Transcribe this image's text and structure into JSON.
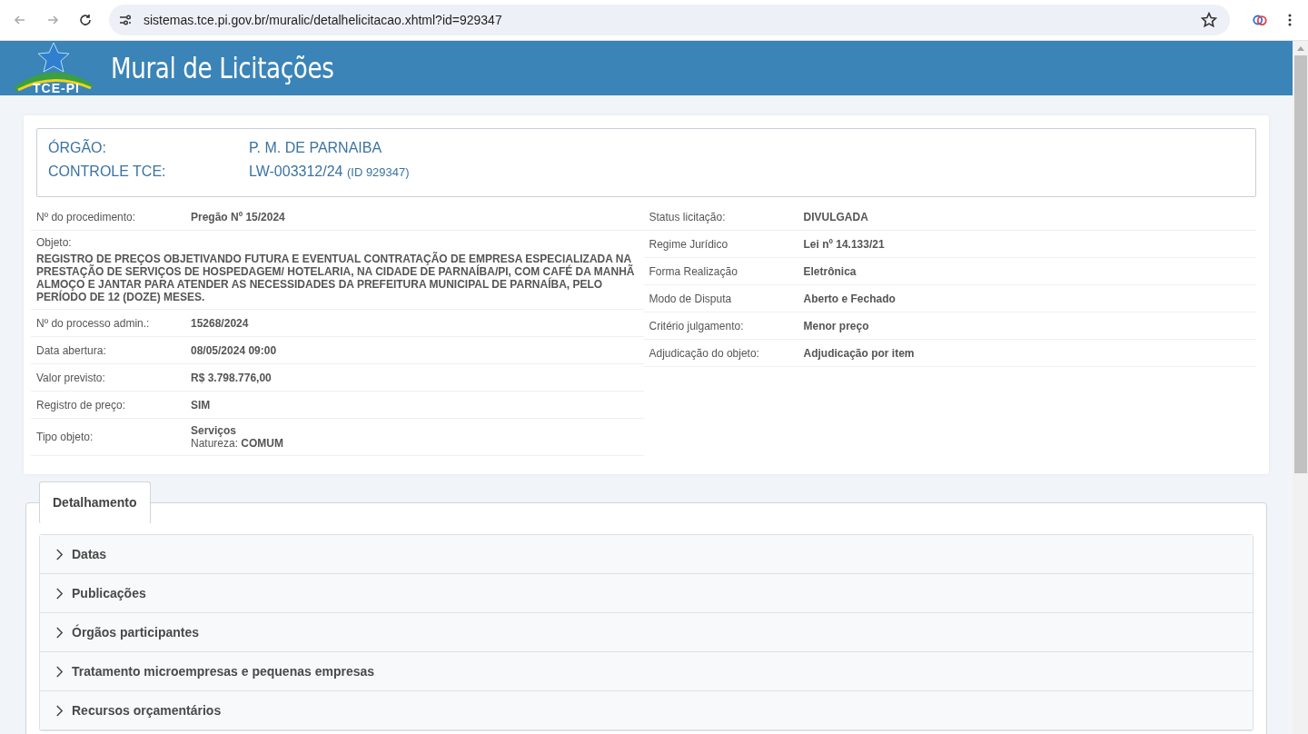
{
  "browser": {
    "url": "sistemas.tce.pi.gov.br/muralic/detalhelicitacao.xhtml?id=929347"
  },
  "header": {
    "logo_text": "TCE-PI",
    "title": "Mural de Licitações"
  },
  "summary": [
    {
      "label": "ÓRGÃO:",
      "value": "P. M. DE PARNAIBA"
    },
    {
      "label": "CONTROLE TCE:",
      "value": "LW-003312/24",
      "note": "(ID 929347)"
    }
  ],
  "details_left": [
    {
      "label": "Nº do procedimento:",
      "value": "Pregão Nº 15/2024"
    },
    {
      "kind": "block",
      "label": "Objeto:",
      "value": "REGISTRO DE PREÇOS OBJETIVANDO FUTURA E EVENTUAL CONTRATAÇÃO DE EMPRESA ESPECIALIZADA NA PRESTAÇÃO DE SERVIÇOS DE HOSPEDAGEM/ HOTELARIA, NA CIDADE DE PARNAÍBA/PI, COM CAFÉ DA MANHÃ ALMOÇO E JANTAR PARA ATENDER AS NECESSIDADES DA PREFEITURA MUNICIPAL DE PARNAÍBA, PELO PERÍODO DE 12 (DOZE) MESES."
    },
    {
      "label": "Nº do processo admin.:",
      "value": "15268/2024"
    },
    {
      "label": "Data abertura:",
      "value": "08/05/2024 09:00"
    },
    {
      "label": "Valor previsto:",
      "value": "R$ 3.798.776,00"
    },
    {
      "label": "Registro de preço:",
      "value": "SIM"
    },
    {
      "label": "Tipo objeto:",
      "value": "Serviços",
      "extra": "Natureza: **COMUM**"
    }
  ],
  "details_right": [
    {
      "label": "Status licitação:",
      "value": "DIVULGADA"
    },
    {
      "label": "Regime Jurídico",
      "value": "Lei nº 14.133/21"
    },
    {
      "label": "Forma Realização",
      "value": "Eletrônica"
    },
    {
      "label": "Modo de Disputa",
      "value": "Aberto e Fechado"
    },
    {
      "label": "Critério julgamento:",
      "value": "Menor preço"
    },
    {
      "label": "Adjudicação do objeto:",
      "value": "Adjudicação por item"
    }
  ],
  "tabs": [
    {
      "label": "Detalhamento",
      "selected": true
    }
  ],
  "sections": [
    {
      "title": "Datas",
      "expanded": false
    },
    {
      "title": "Publicações",
      "expanded": false
    },
    {
      "title": "Órgãos participantes",
      "expanded": false
    },
    {
      "title": "Tratamento microempresas e pequenas empresas",
      "expanded": false
    },
    {
      "title": "Recursos orçamentários",
      "expanded": false
    }
  ]
}
